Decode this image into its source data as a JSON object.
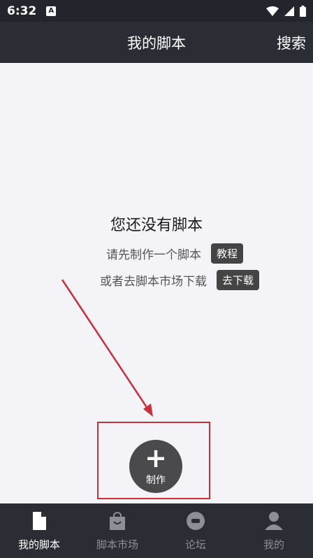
{
  "status_bar": {
    "time": "6:32",
    "badge": "A"
  },
  "header": {
    "title": "我的脚本",
    "search_label": "搜索"
  },
  "empty_state": {
    "title": "您还没有脚本",
    "line1": "请先制作一个脚本",
    "tutorial_button": "教程",
    "line2": "或者去脚本市场下载",
    "download_button": "去下载"
  },
  "fab": {
    "label": "制作"
  },
  "bottom_nav": [
    {
      "label": "我的脚本",
      "icon": "document-icon",
      "active": true
    },
    {
      "label": "脚本市场",
      "icon": "shopping-bag-icon",
      "active": false
    },
    {
      "label": "论坛",
      "icon": "chat-bubble-icon",
      "active": false
    },
    {
      "label": "我的",
      "icon": "person-icon",
      "active": false
    }
  ],
  "colors": {
    "header_bg": "#2b2d35",
    "annotation_red": "#c8313b",
    "fab_bg": "#4a4a4d"
  }
}
